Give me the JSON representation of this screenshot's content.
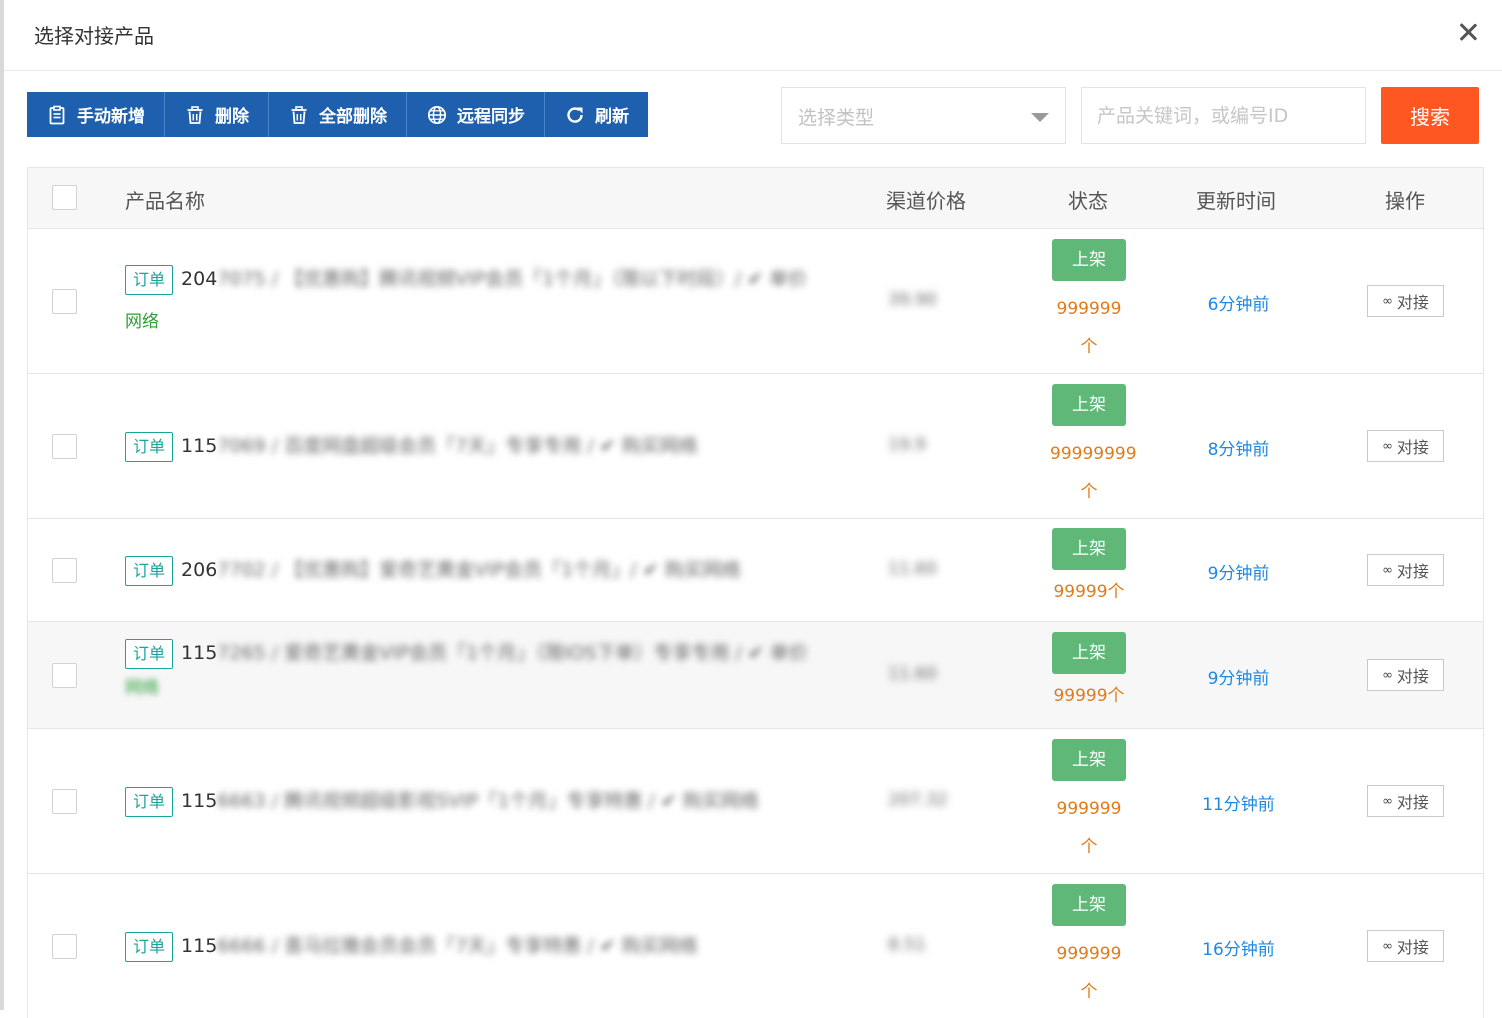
{
  "dialog": {
    "title": "选择对接产品",
    "close_icon": "close-icon"
  },
  "toolbar": {
    "buttons": [
      {
        "label": "手动新增",
        "icon": "clipboard-icon"
      },
      {
        "label": "删除",
        "icon": "trash-icon"
      },
      {
        "label": "全部删除",
        "icon": "trash-icon"
      },
      {
        "label": "远程同步",
        "icon": "globe-icon"
      },
      {
        "label": "刷新",
        "icon": "refresh-icon"
      }
    ],
    "color": "#1e60ad"
  },
  "filter": {
    "type_placeholder": "选择类型",
    "keyword_placeholder": "产品关键词，或编号ID",
    "search_label": "搜索",
    "search_color": "#ff5722"
  },
  "table": {
    "headers": {
      "name": "产品名称",
      "price": "渠道价格",
      "status": "状态",
      "time": "更新时间",
      "op": "操作"
    },
    "rows": [
      {
        "tag": "订单",
        "id_prefix": "204",
        "name_blur": "7075 / 【优惠购】腾讯视频VIP会员「1个月」（限以下时段）/ ✔ 单价",
        "line2": "网络",
        "price_blur": "39.90",
        "status": "上架",
        "stock": "999999",
        "stock_unit": "个",
        "updated": "6分钟前",
        "op": "对接"
      },
      {
        "tag": "订单",
        "id_prefix": "115",
        "name_blur": "7069 / 百度网盘超级会员「7天」专享专用 / ✔ 购买网络",
        "price_blur": "19.9",
        "status": "上架",
        "stock": "99999999",
        "stock_unit": "个",
        "updated": "8分钟前",
        "op": "对接"
      },
      {
        "tag": "订单",
        "id_prefix": "206",
        "name_blur": "7702 / 【优惠购】爱奇艺黄金VIP会员「1个月」/ ✔ 购买网络",
        "price_blur": "11.60",
        "status": "上架",
        "stock": "99999",
        "stock_unit": "个",
        "updated": "9分钟前",
        "op": "对接"
      },
      {
        "tag": "订单",
        "id_prefix": "115",
        "name_blur": "7265 / 爱奇艺黄金VIP会员「1个月」（限IOS下单）专享专用 / ✔ 单价",
        "line2": "网络",
        "price_blur": "11.60",
        "status": "上架",
        "stock": "99999",
        "stock_unit": "个",
        "updated": "9分钟前",
        "op": "对接"
      },
      {
        "tag": "订单",
        "id_prefix": "115",
        "name_blur": "6663 / 腾讯视频超级影视SVIP「1个月」专享特惠 / ✔ 购买网络",
        "price_blur": "207.32",
        "status": "上架",
        "stock": "999999",
        "stock_unit": "个",
        "updated": "11分钟前",
        "op": "对接"
      },
      {
        "tag": "订单",
        "id_prefix": "115",
        "name_blur": "6666 / 喜马拉雅会员会员「7天」专享特惠 / ✔ 购买网络",
        "price_blur": "8.51",
        "status": "上架",
        "stock": "999999",
        "stock_unit": "个",
        "updated": "16分钟前",
        "op": "对接"
      }
    ]
  }
}
